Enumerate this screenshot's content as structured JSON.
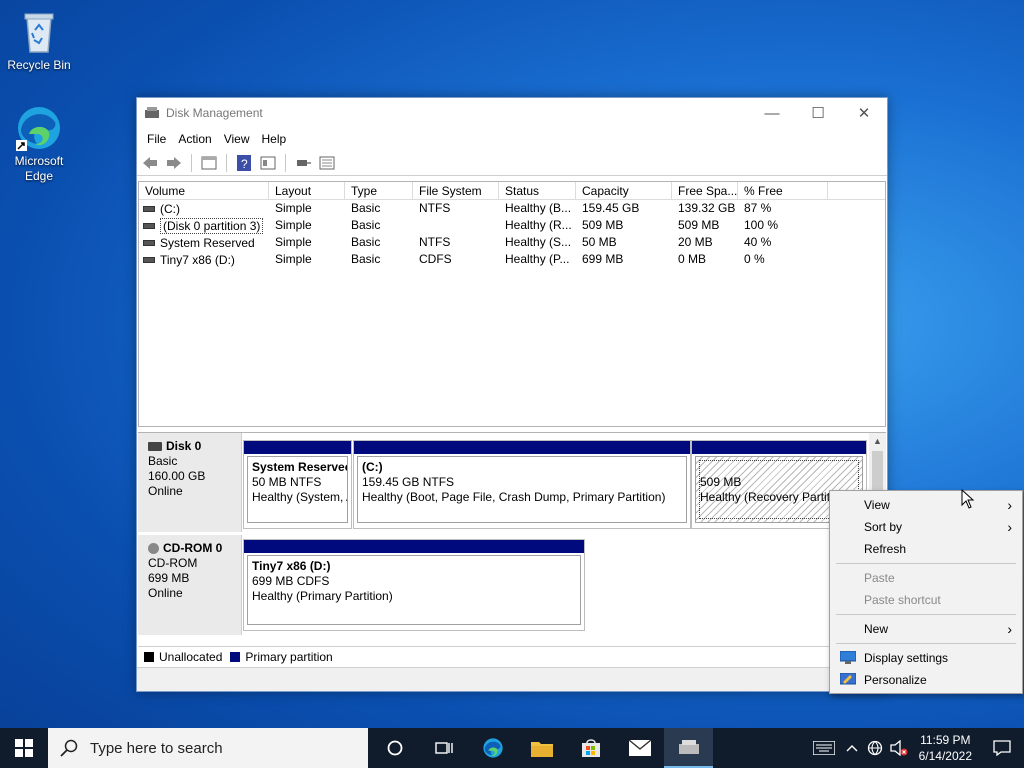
{
  "desktop": {
    "icons": [
      {
        "label": "Recycle Bin"
      },
      {
        "label": "Microsoft Edge"
      }
    ]
  },
  "window": {
    "title": "Disk Management",
    "menu": [
      "File",
      "Action",
      "View",
      "Help"
    ],
    "list": {
      "headers": [
        "Volume",
        "Layout",
        "Type",
        "File System",
        "Status",
        "Capacity",
        "Free Spa...",
        "% Free"
      ],
      "rows": [
        {
          "volume": "(C:)",
          "layout": "Simple",
          "type": "Basic",
          "fs": "NTFS",
          "status": "Healthy (B...",
          "capacity": "159.45 GB",
          "free": "139.32 GB",
          "pct": "87 %"
        },
        {
          "volume": "(Disk 0 partition 3)",
          "layout": "Simple",
          "type": "Basic",
          "fs": "",
          "status": "Healthy (R...",
          "capacity": "509 MB",
          "free": "509 MB",
          "pct": "100 %"
        },
        {
          "volume": "System Reserved",
          "layout": "Simple",
          "type": "Basic",
          "fs": "NTFS",
          "status": "Healthy (S...",
          "capacity": "50 MB",
          "free": "20 MB",
          "pct": "40 %"
        },
        {
          "volume": "Tiny7 x86 (D:)",
          "layout": "Simple",
          "type": "Basic",
          "fs": "CDFS",
          "status": "Healthy (P...",
          "capacity": "699 MB",
          "free": "0 MB",
          "pct": "0 %"
        }
      ]
    },
    "disks": [
      {
        "name": "Disk 0",
        "type": "Basic",
        "size": "160.00 GB",
        "state": "Online",
        "partitions": [
          {
            "name": "System Reservec",
            "line2": "50 MB NTFS",
            "line3": "Healthy (System, A"
          },
          {
            "name": "(C:)",
            "line2": "159.45 GB NTFS",
            "line3": "Healthy (Boot, Page File, Crash Dump, Primary Partition)"
          },
          {
            "name": "",
            "line2": "509 MB",
            "line3": "Healthy (Recovery Partiti"
          }
        ]
      },
      {
        "name": "CD-ROM 0",
        "type": "CD-ROM",
        "size": "699 MB",
        "state": "Online",
        "partitions": [
          {
            "name": "Tiny7 x86  (D:)",
            "line2": "699 MB CDFS",
            "line3": "Healthy (Primary Partition)"
          }
        ]
      }
    ],
    "legend": [
      {
        "label": "Unallocated",
        "color": "#000000"
      },
      {
        "label": "Primary partition",
        "color": "#000a7d"
      }
    ]
  },
  "context_menu": {
    "items": [
      {
        "label": "View",
        "submenu": true,
        "enabled": true
      },
      {
        "label": "Sort by",
        "submenu": true,
        "enabled": true
      },
      {
        "label": "Refresh",
        "submenu": false,
        "enabled": true
      },
      {
        "label": "Paste",
        "submenu": false,
        "enabled": false
      },
      {
        "label": "Paste shortcut",
        "submenu": false,
        "enabled": false
      },
      {
        "label": "New",
        "submenu": true,
        "enabled": true
      },
      {
        "label": "Display settings",
        "submenu": false,
        "enabled": true,
        "icon": "display-icon"
      },
      {
        "label": "Personalize",
        "submenu": false,
        "enabled": true,
        "icon": "personalize-icon"
      }
    ]
  },
  "taskbar": {
    "search_placeholder": "Type here to search",
    "time": "11:59 PM",
    "date": "6/14/2022"
  }
}
